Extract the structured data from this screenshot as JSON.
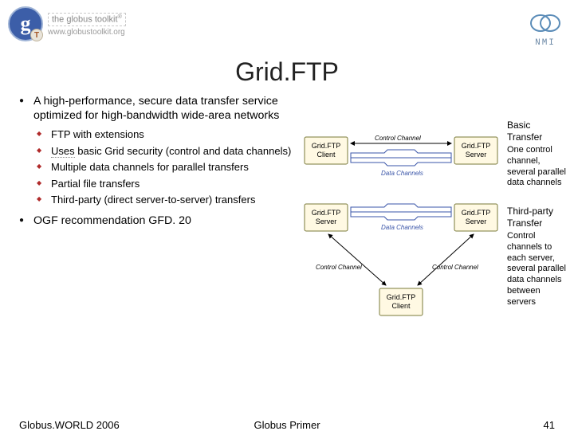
{
  "header": {
    "toolkit_text": "the globus toolkit",
    "toolkit_tm": "®",
    "toolkit_url": "www.globustoolkit.org",
    "nmi_label": "NMI"
  },
  "title": "Grid.FTP",
  "bullets": {
    "b1": "A high-performance, secure data transfer service optimized for high-bandwidth wide-area networks",
    "sub1": "FTP with extensions",
    "sub2a": "Uses",
    "sub2b": " basic Grid security (control and data channels)",
    "sub3": "Multiple data channels for parallel transfers",
    "sub4": "Partial file transfers",
    "sub5": "Third-party (direct server-to-server) transfers",
    "b2": "OGF recommendation GFD. 20"
  },
  "diagram": {
    "client": "Grid.FTP\nClient",
    "server": "Grid.FTP\nServer",
    "control": "Control Channel",
    "data": "Data Channels"
  },
  "annotations": {
    "basic_title": "Basic Transfer",
    "basic_body": "One control channel, several parallel data channels",
    "third_title": "Third-party Transfer",
    "third_body": "Control channels to each server, several parallel data channels between servers"
  },
  "footer": {
    "left": "Globus.WORLD 2006",
    "center": "Globus Primer",
    "right": "41"
  }
}
